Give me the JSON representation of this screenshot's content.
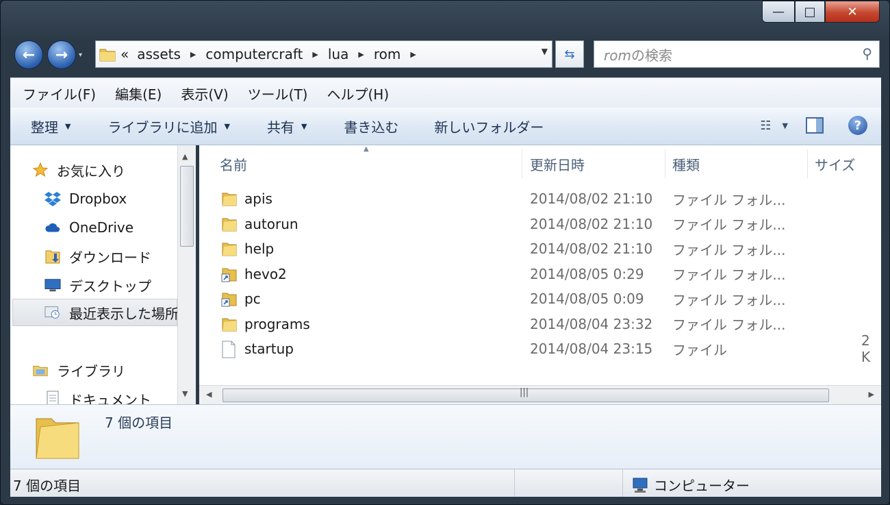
{
  "window": {
    "caption": {
      "minimize": "—",
      "maximize": "□",
      "close": "✕"
    }
  },
  "nav": {
    "back": "←",
    "forward": "→",
    "history": "▾"
  },
  "address": {
    "overflow": "«",
    "crumbs": [
      "assets",
      "computercraft",
      "lua",
      "rom"
    ]
  },
  "search": {
    "placeholder_prefix": "rom",
    "placeholder_suffix": "の検索"
  },
  "menu": [
    "ファイル(F)",
    "編集(E)",
    "表示(V)",
    "ツール(T)",
    "ヘルプ(H)"
  ],
  "commands": {
    "organize": "整理",
    "add_library": "ライブラリに追加",
    "share": "共有",
    "burn": "書き込む",
    "new_folder": "新しいフォルダー"
  },
  "navpane": {
    "items": [
      {
        "label": "お気に入り",
        "icon": "star-icon"
      },
      {
        "label": "Dropbox",
        "icon": "dropbox-icon"
      },
      {
        "label": "OneDrive",
        "icon": "cloud-icon"
      },
      {
        "label": "ダウンロード",
        "icon": "downloads-folder-icon"
      },
      {
        "label": "デスクトップ",
        "icon": "desktop-icon"
      },
      {
        "label": "最近表示した場所",
        "icon": "recent-places-icon"
      },
      {
        "label": "ライブラリ",
        "icon": "library-icon"
      },
      {
        "label": "ドキュメント",
        "icon": "document-icon"
      }
    ]
  },
  "columns": {
    "name": "名前",
    "date": "更新日時",
    "type": "種類",
    "size": "サイズ"
  },
  "files": [
    {
      "name": "apis",
      "date": "2014/08/02 21:10",
      "type": "ファイル フォル...",
      "size": "",
      "kind": "folder"
    },
    {
      "name": "autorun",
      "date": "2014/08/02 21:10",
      "type": "ファイル フォル...",
      "size": "",
      "kind": "folder"
    },
    {
      "name": "help",
      "date": "2014/08/02 21:10",
      "type": "ファイル フォル...",
      "size": "",
      "kind": "folder"
    },
    {
      "name": "hevo2",
      "date": "2014/08/05 0:29",
      "type": "ファイル フォル...",
      "size": "",
      "kind": "shortcut"
    },
    {
      "name": "pc",
      "date": "2014/08/05 0:09",
      "type": "ファイル フォル...",
      "size": "",
      "kind": "shortcut"
    },
    {
      "name": "programs",
      "date": "2014/08/04 23:32",
      "type": "ファイル フォル...",
      "size": "",
      "kind": "folder"
    },
    {
      "name": "startup",
      "date": "2014/08/04 23:15",
      "type": "ファイル",
      "size": "2 K",
      "kind": "file"
    }
  ],
  "details": {
    "count": "7 個の項目"
  },
  "status": {
    "left": "7 個の項目",
    "right": "コンピューター"
  }
}
